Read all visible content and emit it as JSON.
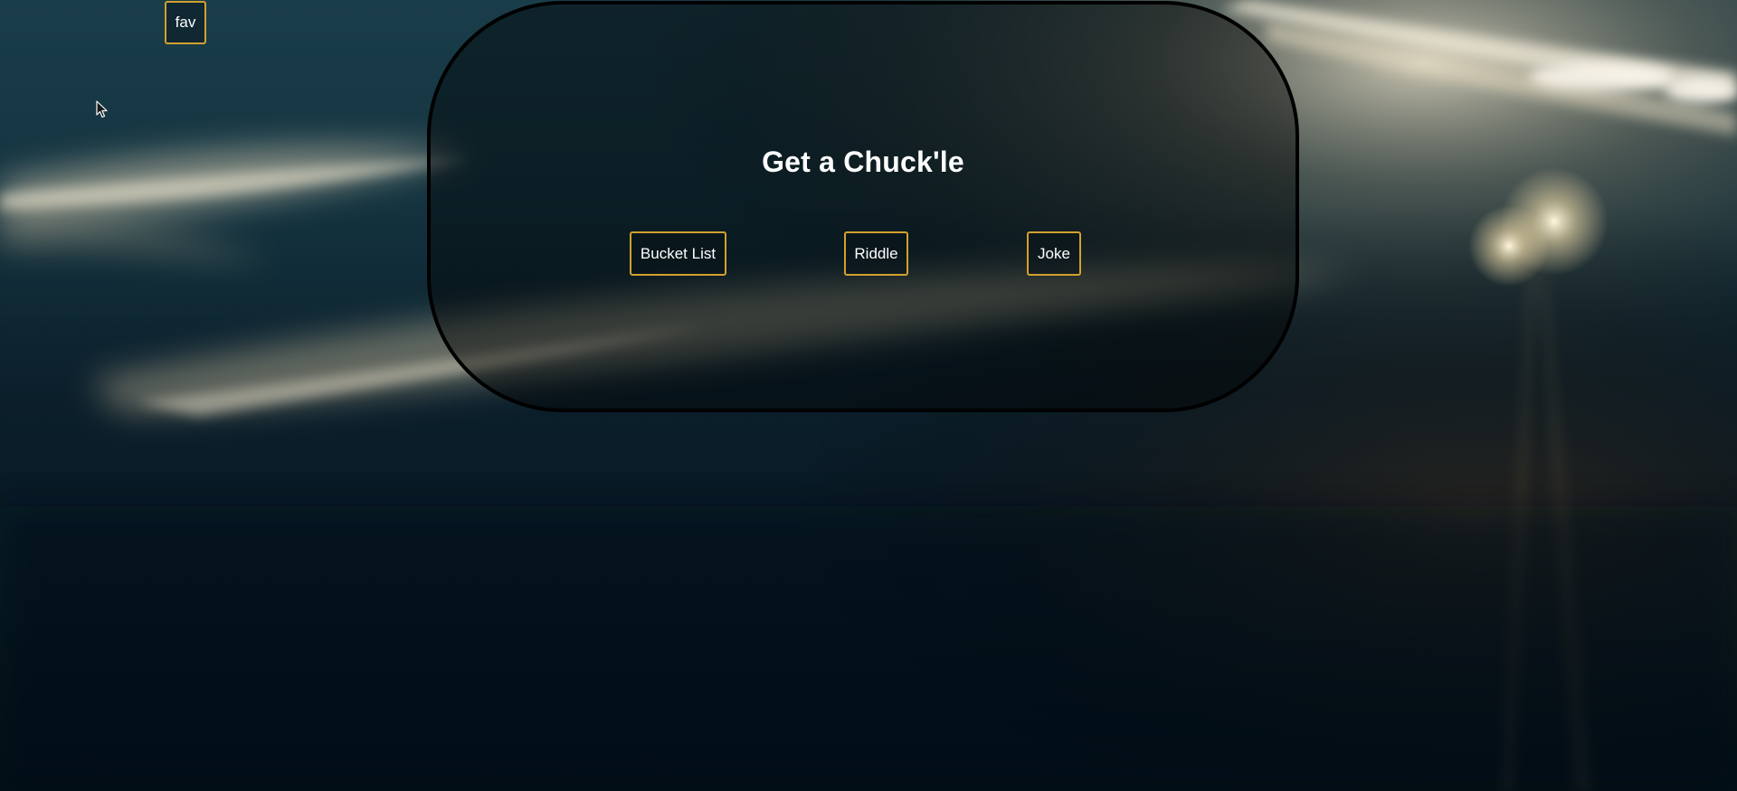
{
  "header": {
    "fav_label": "fav"
  },
  "card": {
    "title": "Get a Chuck'le",
    "buttons": {
      "bucket_list": "Bucket List",
      "riddle": "Riddle",
      "joke": "Joke"
    }
  },
  "colors": {
    "button_border": "#d2a12d",
    "card_border": "#000000",
    "text": "#ffffff"
  },
  "icons": {
    "pointer": "mouse-pointer-icon"
  }
}
